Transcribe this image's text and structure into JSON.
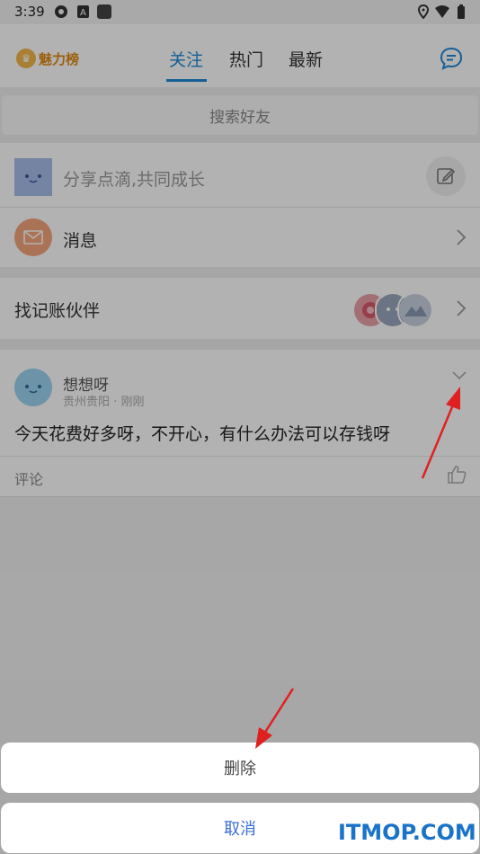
{
  "status_bar": {
    "time": "3:39",
    "icons_left": [
      "gear-icon",
      "a-icon",
      "square-icon"
    ],
    "icons_right": [
      "location-icon",
      "wifi-icon",
      "battery-icon"
    ]
  },
  "header": {
    "logo_text": "魅力榜",
    "tabs": [
      "关注",
      "热门",
      "最新"
    ],
    "active_tab": "关注",
    "message_icon": "chat-bubble-icon"
  },
  "search": {
    "placeholder": "搜索好友"
  },
  "share": {
    "text": "分享点滴,共同成长",
    "edit_icon": "edit-icon"
  },
  "messages": {
    "label": "消息",
    "icon": "mail-icon"
  },
  "partner": {
    "label": "找记账伙伴"
  },
  "post": {
    "name": "想想呀",
    "location": "贵州贵阳",
    "separator": "·",
    "time": "刚刚",
    "content": "今天花费好多呀，不开心，有什么办法可以存钱呀",
    "comment_label": "评论",
    "like_icon": "thumbs-up-icon",
    "more_icon": "chevron-down-icon"
  },
  "action_sheet": {
    "delete_label": "删除",
    "cancel_label": "取消"
  },
  "watermark": "ITMOP.COM",
  "colors": {
    "accent": "#1e88d6",
    "cancel_text": "#3b6fd8",
    "arrow": "#e02020"
  }
}
